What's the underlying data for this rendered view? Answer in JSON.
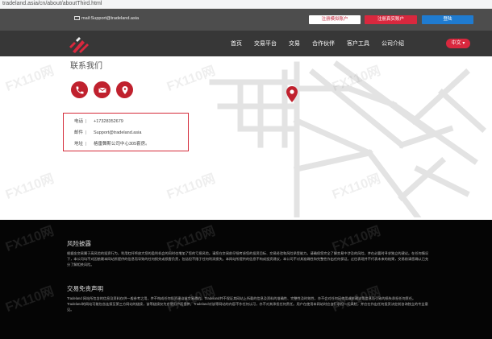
{
  "browser": {
    "url": "tradeland.asia/cn/about/aboutThird.html"
  },
  "topbar": {
    "email": "mail:Support@tradeland.asia",
    "demo_button": "注册模拟账户",
    "live_button": "注册真实账户",
    "login_button": "登陆"
  },
  "nav": {
    "items": [
      "首页",
      "交易平台",
      "交易",
      "合作伙伴",
      "客户工具",
      "公司介绍"
    ],
    "language": "中文 ▾"
  },
  "contact": {
    "title": "联系我们",
    "rows": [
      {
        "key": "电话",
        "value": "+17328352679"
      },
      {
        "key": "邮件",
        "value": "Support@tradeland.asia"
      },
      {
        "key": "地址",
        "value": "格雷舞斯公司中心305套房。"
      }
    ]
  },
  "footer": {
    "risk_title": "风险披露",
    "risk_text": "根据金交易属于高风险的投资行为，利用杠杆将放大您的盈利机会的同时也增加了您的亏损风险。请您在交易前仔细考虑您的投资目标、交易经验和风险承受能力。请确保您完全了解交易中涉及的风险，并在必要时寻求独立的建议。在任何情况下，本公司均不对因依赖本网站所提供的信息而导致的任何损失或损害负责，包括但不限于任何利润损失。本网站所提供的信息不构成投资建议，本公司不对其准确性和完整性作出任何保证。过往表现并不代表未来的结果，交易前请您确认已充分了解相关风险。",
    "disclaimer_title": "交易免责声明",
    "disclaimer_text": "Tradeland 网站所包含的信息及资料仅供一般参考之用，并不构成任何投资建议或交易邀约。Tradeland并不保证其网站上所载的信息及资料的准确性、完整性及时效性，亦不会对任何因使用或依赖该等信息而引致的损失承担任何责任。Tradeland的网站可能包含连接至第三方网站的链接，该等链接仅为方便用户而提供，Tradeland对该等网站的内容不作任何认可，亦不对其承担任何责任。用户在使用本网站时应自行承担一切风险，并应在作出任何投资决定前咨询独立的专业意见。"
  },
  "watermark": "FX110网",
  "colors": {
    "accent": "#d9283e",
    "login": "#1f7bd0",
    "icon_red": "#c0212e"
  }
}
